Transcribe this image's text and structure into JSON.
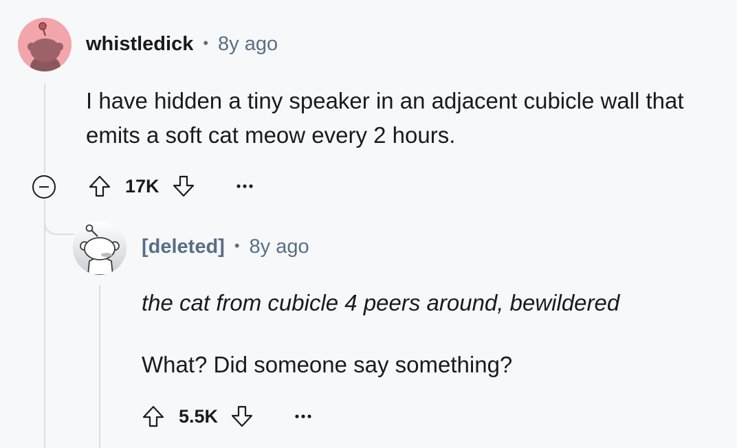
{
  "comment": {
    "username": "whistledick",
    "separator": "•",
    "time": "8y ago",
    "body": "I have hidden a tiny speaker in an adjacent cubicle wall that emits a soft cat meow every 2 hours.",
    "score": "17K",
    "icons": {
      "avatar": "snoo-avatar-icon",
      "upvote": "arrow-up-icon",
      "downvote": "arrow-down-icon",
      "more": "more-options-icon",
      "collapse": "collapse-icon"
    },
    "avatar_color": "#f2a5ab"
  },
  "reply": {
    "username": "[deleted]",
    "separator": "•",
    "time": "8y ago",
    "body_line1": "the cat from cubicle 4 peers around, bewildered",
    "body_line2": "What? Did someone say something?",
    "score": "5.5K",
    "avatar_color": "#dfe3e8"
  },
  "colors": {
    "background": "#f7f8fa",
    "text": "#1a1a1b",
    "meta": "#576f85",
    "thread_line": "#d6dde3"
  }
}
